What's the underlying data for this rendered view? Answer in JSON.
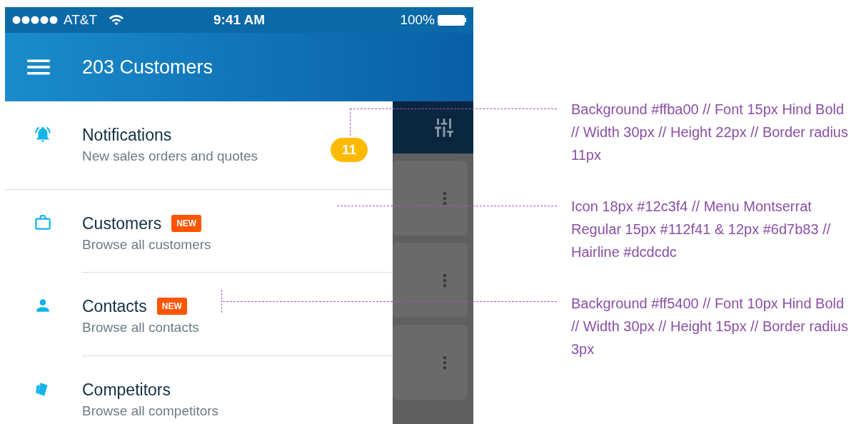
{
  "status_bar": {
    "carrier": "AT&T",
    "time": "9:41 AM",
    "battery": "100%"
  },
  "header": {
    "title": "203 Customers"
  },
  "menu": [
    {
      "title": "Notifications",
      "subtitle": "New sales orders and quotes",
      "count": "11"
    },
    {
      "title": "Customers",
      "subtitle": "Browse all customers",
      "tag": "NEW"
    },
    {
      "title": "Contacts",
      "subtitle": "Browse all contacts",
      "tag": "NEW"
    },
    {
      "title": "Competitors",
      "subtitle": "Browse all competitors"
    }
  ],
  "annotations": [
    "Background #ffba00 // Font 15px Hind Bold // Width 30px // Height 22px // Border radius 11px",
    "Icon 18px #12c3f4 // Menu Montserrat Regular 15px #112f41 & 12px #6d7b83 // Hairline #dcdcdc",
    "Background #ff5400 // Font 10px Hind Bold // Width 30px // Height 15px // Border radius 3px"
  ]
}
